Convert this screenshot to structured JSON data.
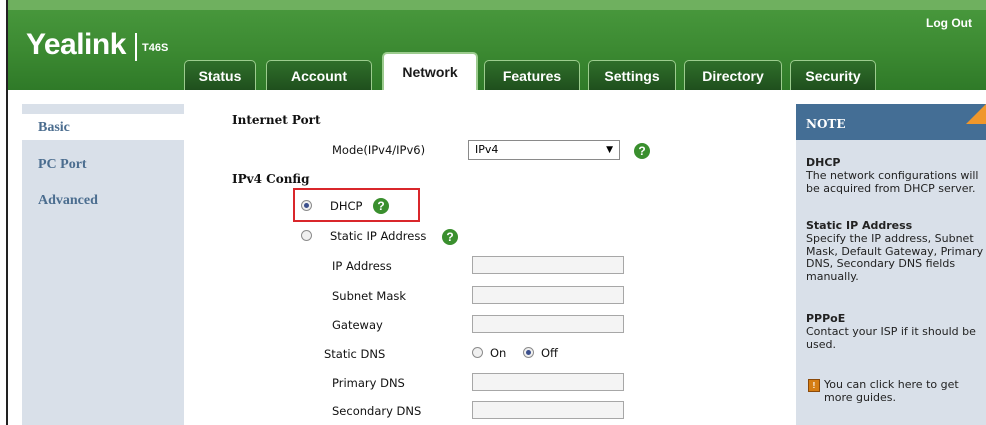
{
  "header": {
    "logo": "Yealink",
    "model": "T46S",
    "logout_label": "Log Out"
  },
  "tabs": [
    {
      "label": "Status",
      "active": false
    },
    {
      "label": "Account",
      "active": false
    },
    {
      "label": "Network",
      "active": true
    },
    {
      "label": "Features",
      "active": false
    },
    {
      "label": "Settings",
      "active": false
    },
    {
      "label": "Directory",
      "active": false
    },
    {
      "label": "Security",
      "active": false
    }
  ],
  "sidebar": {
    "items": [
      {
        "label": "Basic",
        "active": true
      },
      {
        "label": "PC Port",
        "active": false
      },
      {
        "label": "Advanced",
        "active": false
      }
    ]
  },
  "form": {
    "internet_port_title": "Internet Port",
    "mode_label": "Mode(IPv4/IPv6)",
    "mode_value": "IPv4",
    "ipv4_title": "IPv4 Config",
    "dhcp_label": "DHCP",
    "dhcp_selected": true,
    "static_ip_label": "Static IP Address",
    "static_ip_selected": false,
    "ip_address_label": "IP Address",
    "ip_address_value": "",
    "subnet_mask_label": "Subnet Mask",
    "subnet_mask_value": "",
    "gateway_label": "Gateway",
    "gateway_value": "",
    "static_dns_label": "Static DNS",
    "static_dns_on_label": "On",
    "static_dns_off_label": "Off",
    "static_dns_value": "Off",
    "primary_dns_label": "Primary DNS",
    "primary_dns_value": "",
    "secondary_dns_label": "Secondary DNS",
    "secondary_dns_value": ""
  },
  "note": {
    "title": "NOTE",
    "dhcp_heading": "DHCP",
    "dhcp_text": "The network configurations will be acquired from DHCP server.",
    "static_heading": "Static IP Address",
    "static_text": "Specify the IP address, Subnet Mask, Default Gateway, Primary DNS, Secondary DNS fields manually.",
    "pppoe_heading": "PPPoE",
    "pppoe_text": "Contact your ISP if it should be used.",
    "guide_text": "You can click here to get more guides."
  },
  "colors": {
    "header_green": "#3c8a32",
    "sidebar_bg": "#d9e0e9",
    "note_head": "#446e95",
    "highlight_red": "#d9262b",
    "help_green": "#3a8f2e"
  }
}
